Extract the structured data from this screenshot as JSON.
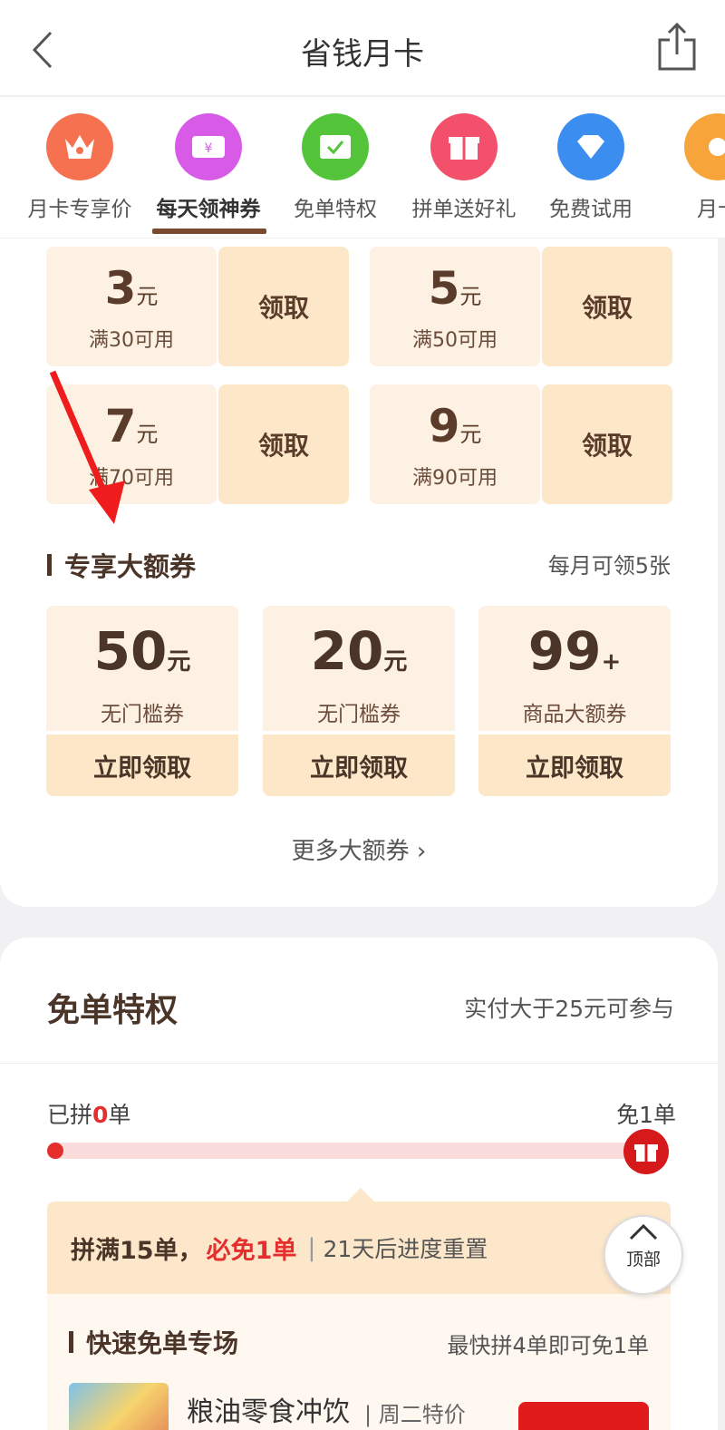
{
  "header": {
    "title": "省钱月卡"
  },
  "tabs": [
    {
      "label": "月卡专享价",
      "color": "#f5714f",
      "icon": "crown-icon"
    },
    {
      "label": "每天领神券",
      "color": "#d85be8",
      "icon": "ticket-icon"
    },
    {
      "label": "免单特权",
      "color": "#54c43a",
      "icon": "check-card-icon"
    },
    {
      "label": "拼单送好礼",
      "color": "#f2506b",
      "icon": "gift-icon"
    },
    {
      "label": "免费试用",
      "color": "#3b8ef0",
      "icon": "diamond-icon"
    },
    {
      "label": "月卡",
      "color": "#f7a53b",
      "icon": "coin-icon"
    }
  ],
  "coupons": [
    {
      "amount": "3",
      "unit": "元",
      "condition": "满30可用",
      "action": "领取"
    },
    {
      "amount": "5",
      "unit": "元",
      "condition": "满50可用",
      "action": "领取"
    },
    {
      "amount": "7",
      "unit": "元",
      "condition": "满70可用",
      "action": "领取"
    },
    {
      "amount": "9",
      "unit": "元",
      "condition": "满90可用",
      "action": "领取"
    }
  ],
  "big_section": {
    "title": "专享大额券",
    "note": "每月可领5张",
    "items": [
      {
        "amount": "50",
        "unit": "元",
        "desc": "无门槛券",
        "action": "立即领取"
      },
      {
        "amount": "20",
        "unit": "元",
        "desc": "无门槛券",
        "action": "立即领取"
      },
      {
        "amount": "99",
        "unit": "+",
        "desc": "商品大额券",
        "action": "立即领取"
      }
    ],
    "more": "更多大额券 ›"
  },
  "free_section": {
    "title": "免单特权",
    "note": "实付大于25元可参与",
    "progress_prefix": "已拼",
    "progress_count": "0",
    "progress_suffix": "单",
    "progress_fraction": 0.02,
    "goal": "免1单",
    "banner_main": "拼满15单，",
    "banner_red": "必免1单",
    "banner_sep": "|",
    "banner_reset": "21天后进度重置",
    "quick_title": "快速免单专场",
    "quick_note": "最快拼4单即可免1单",
    "product_name": "粮油零食冲饮",
    "product_tag": "| 周二特价"
  },
  "to_top": {
    "label": "顶部"
  }
}
